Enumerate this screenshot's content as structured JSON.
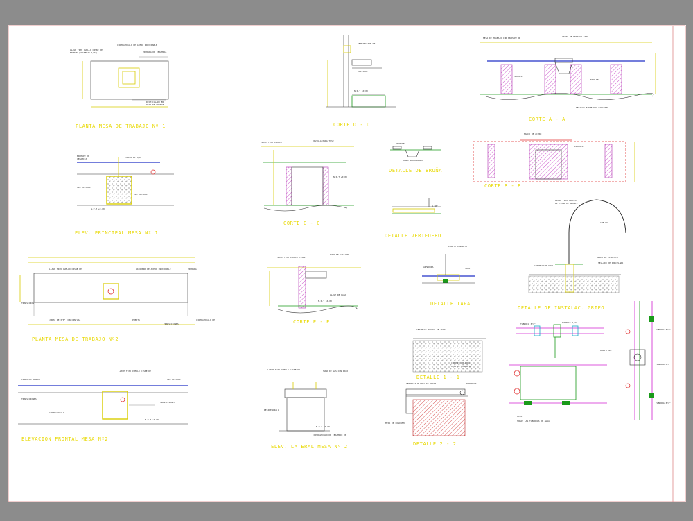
{
  "sheet": {
    "views": [
      {
        "id": "planta-mesa-1",
        "title": "PLANTA MESA DE TRABAJO Nº 1"
      },
      {
        "id": "corte-d-d",
        "title": "CORTE D - D"
      },
      {
        "id": "corte-a-a",
        "title": "CORTE A - A"
      },
      {
        "id": "corte-b-b",
        "title": "CORTE B - B"
      },
      {
        "id": "elev-principal-mesa-1",
        "title": "ELEV. PRINCIPAL MESA Nº 1"
      },
      {
        "id": "corte-c-c",
        "title": "CORTE C - C"
      },
      {
        "id": "detalle-bruna",
        "title": "DETALLE DE BRUÑA"
      },
      {
        "id": "detalle-vertedero",
        "title": "DETALLE VERTEDERO"
      },
      {
        "id": "planta-mesa-2",
        "title": "PLANTA MESA DE TRABAJO Nº2"
      },
      {
        "id": "corte-e-e",
        "title": "CORTE E - E"
      },
      {
        "id": "detalle-tapa",
        "title": "DETALLE TAPA"
      },
      {
        "id": "detalle-instalac-grifo",
        "title": "DETALLE DE INSTALAC. GRIFO"
      },
      {
        "id": "elev-frontal-mesa-2",
        "title": "ELEVACION FRONTAL MESA Nº2"
      },
      {
        "id": "elev-lateral-mesa-2",
        "title": "ELEV. LATERAL MESA Nº 2"
      },
      {
        "id": "detalle-1",
        "title": "DETALLE 1 - 1"
      },
      {
        "id": "detalle-2",
        "title": "DETALLE 2 - 2"
      }
    ]
  }
}
